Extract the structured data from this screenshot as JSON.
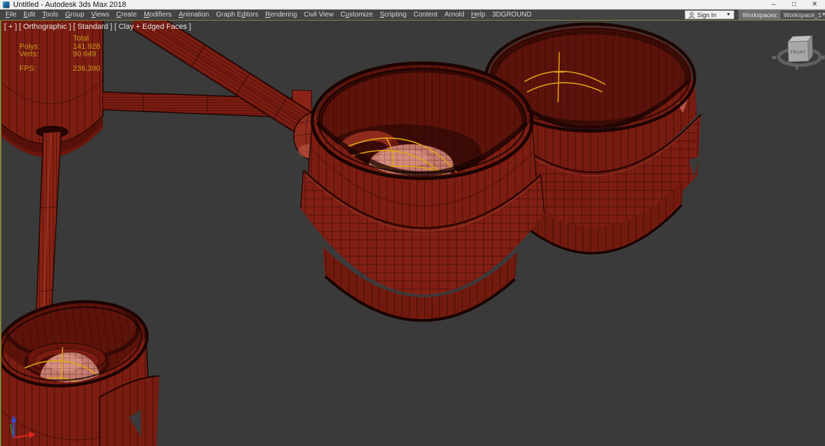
{
  "window": {
    "title": "Untitled - Autodesk 3ds Max 2018",
    "minimize": "–",
    "maximize": "□",
    "close": "✕"
  },
  "menubar": {
    "items": [
      {
        "label": "File",
        "u": 0
      },
      {
        "label": "Edit",
        "u": 0
      },
      {
        "label": "Tools",
        "u": 0
      },
      {
        "label": "Group",
        "u": 0
      },
      {
        "label": "Views",
        "u": 0
      },
      {
        "label": "Create",
        "u": 0
      },
      {
        "label": "Modifiers",
        "u": 0
      },
      {
        "label": "Animation",
        "u": 0
      },
      {
        "label": "Graph Editors",
        "u": 7
      },
      {
        "label": "Rendering",
        "u": 0
      },
      {
        "label": "Civil View",
        "u": -1
      },
      {
        "label": "Customize",
        "u": 1
      },
      {
        "label": "Scripting",
        "u": 0
      },
      {
        "label": "Content",
        "u": -1
      },
      {
        "label": "Arnold",
        "u": -1
      },
      {
        "label": "Help",
        "u": 0
      },
      {
        "label": "3DGROUND",
        "u": -1
      }
    ],
    "sign_in_label": "Sign In",
    "workspaces_label": "Workspaces:",
    "workspace_value": "Workspace_1"
  },
  "viewport": {
    "label_segments": [
      "[ + ]",
      "[ Orthographic ]",
      "[ Standard ]",
      "[ Clay + Edged Faces ]"
    ],
    "stats": {
      "total_label": "Total",
      "polys_label": "Polys:",
      "polys_value": "141 928",
      "verts_label": "Verts:",
      "verts_value": "90 649",
      "fps_label": "FPS:",
      "fps_value": "236,390"
    },
    "viewcube": {
      "front_label": "FRONT",
      "west": "W",
      "south": "S",
      "east": "E"
    },
    "colors": {
      "background": "#3a3a3a",
      "active_border": "#83833a",
      "barrel_red": "#7d1d12",
      "wire_dark": "#1d0402",
      "spline_yellow": "#e0a513",
      "dome_pink": "#c67f72",
      "stats_text": "#c9991c"
    }
  }
}
